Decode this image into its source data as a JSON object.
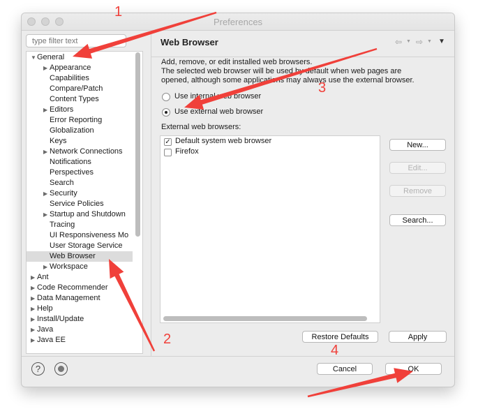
{
  "window": {
    "title": "Preferences"
  },
  "filter": {
    "placeholder": "type filter text"
  },
  "tree": [
    {
      "label": "General",
      "level": 0,
      "state": "expanded"
    },
    {
      "label": "Appearance",
      "level": 1,
      "state": "collapsed"
    },
    {
      "label": "Capabilities",
      "level": 1,
      "state": "leaf"
    },
    {
      "label": "Compare/Patch",
      "level": 1,
      "state": "leaf"
    },
    {
      "label": "Content Types",
      "level": 1,
      "state": "leaf"
    },
    {
      "label": "Editors",
      "level": 1,
      "state": "collapsed"
    },
    {
      "label": "Error Reporting",
      "level": 1,
      "state": "leaf"
    },
    {
      "label": "Globalization",
      "level": 1,
      "state": "leaf"
    },
    {
      "label": "Keys",
      "level": 1,
      "state": "leaf"
    },
    {
      "label": "Network Connections",
      "level": 1,
      "state": "collapsed"
    },
    {
      "label": "Notifications",
      "level": 1,
      "state": "leaf"
    },
    {
      "label": "Perspectives",
      "level": 1,
      "state": "leaf"
    },
    {
      "label": "Search",
      "level": 1,
      "state": "leaf"
    },
    {
      "label": "Security",
      "level": 1,
      "state": "collapsed"
    },
    {
      "label": "Service Policies",
      "level": 1,
      "state": "leaf"
    },
    {
      "label": "Startup and Shutdown",
      "level": 1,
      "state": "collapsed"
    },
    {
      "label": "Tracing",
      "level": 1,
      "state": "leaf"
    },
    {
      "label": "UI Responsiveness Mo",
      "level": 1,
      "state": "leaf"
    },
    {
      "label": "User Storage Service",
      "level": 1,
      "state": "leaf"
    },
    {
      "label": "Web Browser",
      "level": 1,
      "state": "leaf",
      "selected": true
    },
    {
      "label": "Workspace",
      "level": 1,
      "state": "collapsed"
    },
    {
      "label": "Ant",
      "level": 0,
      "state": "collapsed"
    },
    {
      "label": "Code Recommender",
      "level": 0,
      "state": "collapsed"
    },
    {
      "label": "Data Management",
      "level": 0,
      "state": "collapsed"
    },
    {
      "label": "Help",
      "level": 0,
      "state": "collapsed"
    },
    {
      "label": "Install/Update",
      "level": 0,
      "state": "collapsed"
    },
    {
      "label": "Java",
      "level": 0,
      "state": "collapsed"
    },
    {
      "label": "Java EE",
      "level": 0,
      "state": "collapsed"
    }
  ],
  "page": {
    "title": "Web Browser",
    "description_line1": "Add, remove, or edit installed web browsers.",
    "description_line2": "The selected web browser will be used by default when web pages are",
    "description_line3": "opened, although some applications may always use the external browser.",
    "radio_internal": "Use internal web browser",
    "radio_external": "Use external web browser",
    "selected_option": "external",
    "section_label": "External web browsers:",
    "browsers": [
      {
        "label": "Default system web browser",
        "checked": true
      },
      {
        "label": "Firefox",
        "checked": false
      }
    ],
    "buttons": {
      "new": "New...",
      "edit": "Edit...",
      "remove": "Remove",
      "search": "Search...",
      "restore_defaults": "Restore Defaults",
      "apply": "Apply"
    }
  },
  "dialog": {
    "cancel": "Cancel",
    "ok": "OK"
  },
  "annotations": {
    "color": "#f0403a",
    "labels": [
      "1",
      "2",
      "3",
      "4"
    ]
  }
}
